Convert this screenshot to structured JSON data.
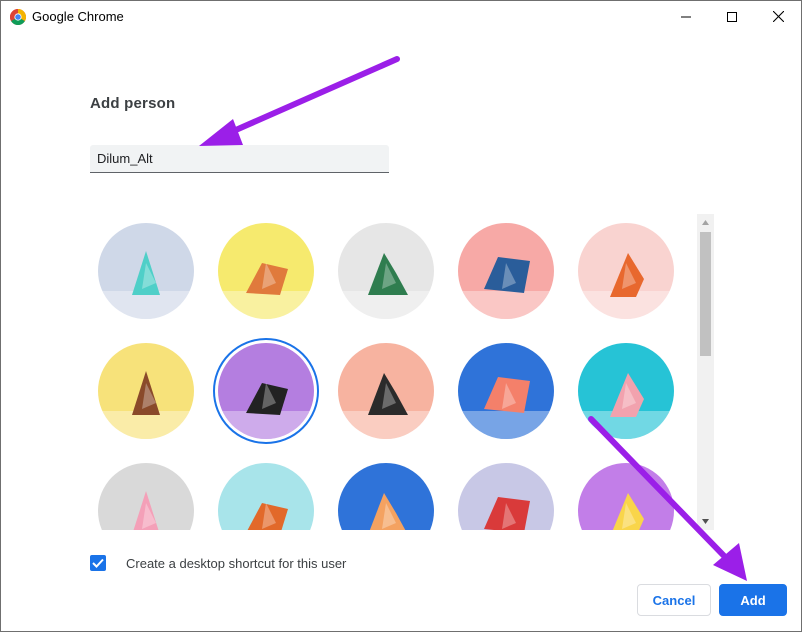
{
  "window": {
    "title": "Google Chrome",
    "icon": "chrome-logo-icon",
    "controls": [
      "minimize-icon",
      "maximize-icon",
      "close-icon"
    ]
  },
  "dialog": {
    "heading": "Add person",
    "name_input": {
      "value": "Dilum_Alt",
      "placeholder": ""
    },
    "avatars": [
      {
        "name": "origami-cat-avatar",
        "bg": "#cfd8e8",
        "accent": "#4fcfc8",
        "selected": false
      },
      {
        "name": "origami-corgi-avatar",
        "bg": "#f6ea6e",
        "accent": "#e07a3c",
        "selected": false
      },
      {
        "name": "origami-dragon-avatar",
        "bg": "#e6e6e6",
        "accent": "#2f7d4f",
        "selected": false
      },
      {
        "name": "origami-elephant-avatar",
        "bg": "#f7a9a6",
        "accent": "#2a5d9a",
        "selected": false
      },
      {
        "name": "origami-fox-avatar",
        "bg": "#f9d3d0",
        "accent": "#e8682e",
        "selected": false
      },
      {
        "name": "origami-monkey-avatar",
        "bg": "#f7e27a",
        "accent": "#8a4a2a",
        "selected": false
      },
      {
        "name": "origami-panda-avatar",
        "bg": "#b47ee0",
        "accent": "#222222",
        "selected": true
      },
      {
        "name": "origami-penguin-avatar",
        "bg": "#f7b3a0",
        "accent": "#2b2b2b",
        "selected": false
      },
      {
        "name": "origami-butterfly-avatar",
        "bg": "#2f73d9",
        "accent": "#f4806a",
        "selected": false
      },
      {
        "name": "origami-rabbit-avatar",
        "bg": "#26c3d6",
        "accent": "#f2a2ae",
        "selected": false
      },
      {
        "name": "origami-unicorn-avatar",
        "bg": "#d9d9d9",
        "accent": "#f4a0b8",
        "selected": false
      },
      {
        "name": "basketball-avatar",
        "bg": "#a8e4ea",
        "accent": "#e2692a",
        "selected": false
      },
      {
        "name": "bicycle-avatar",
        "bg": "#2f73d9",
        "accent": "#f4a261",
        "selected": false
      },
      {
        "name": "origami-bird-avatar",
        "bg": "#c8c8e6",
        "accent": "#d93a3a",
        "selected": false
      },
      {
        "name": "cheese-avatar",
        "bg": "#c27ee8",
        "accent": "#f9d54a",
        "selected": false
      }
    ],
    "shortcut": {
      "label": "Create a desktop shortcut for this user",
      "checked": true
    },
    "buttons": {
      "cancel_label": "Cancel",
      "add_label": "Add"
    }
  },
  "colors": {
    "accent": "#1a73e8",
    "annotation_arrow": "#9b1fe8"
  }
}
